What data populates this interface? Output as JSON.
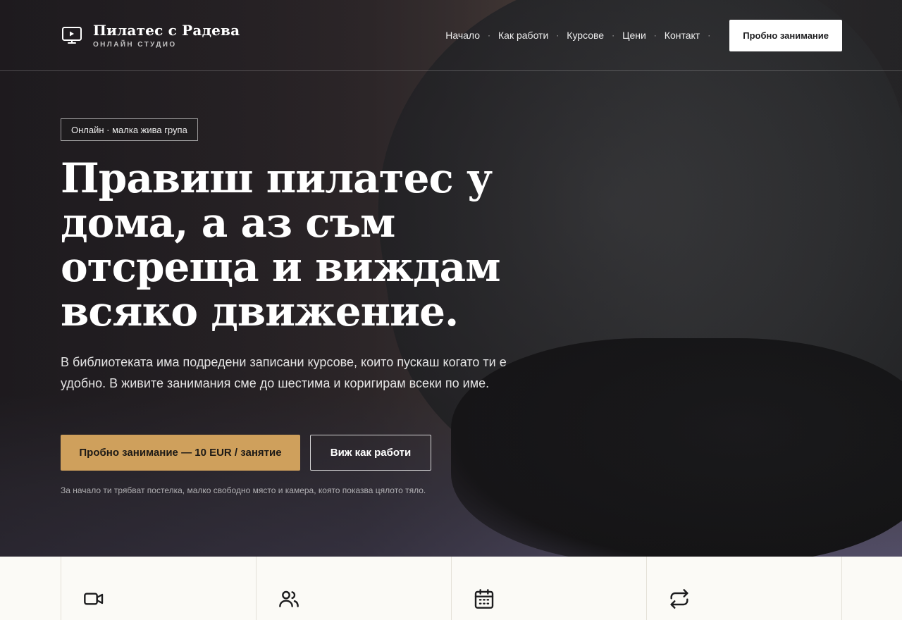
{
  "brand": {
    "title": "Пилатес с Радева",
    "subtitle": "ОНЛАЙН СТУДИО",
    "icon": "monitor-play-icon"
  },
  "nav": {
    "items": [
      {
        "label": "Начало"
      },
      {
        "label": "Как работи"
      },
      {
        "label": "Курсове"
      },
      {
        "label": "Цени"
      },
      {
        "label": "Контакт"
      }
    ],
    "separator": "·",
    "cta_label": "Пробно занимание"
  },
  "hero": {
    "badge": "Онлайн · малка жива група",
    "headline": "Правиш пилатес у дома, а аз съм отсреща и виждам всяко движение.",
    "lead": "В библиотеката има подредени записани курсове, които пускаш когато ти е удобно. В живите занимания сме до шестима и коригирам всеки по име.",
    "primary_cta": "Пробно занимание — 10 EUR / занятие",
    "secondary_cta": "Виж как работи",
    "note": "За начало ти трябват постелка, малко свободно място и камера, която показва цялото тяло."
  },
  "features": [
    {
      "icon": "video-camera-icon"
    },
    {
      "icon": "users-icon"
    },
    {
      "icon": "calendar-icon"
    },
    {
      "icon": "repeat-icon"
    }
  ],
  "colors": {
    "accent": "#cfa05c",
    "page_bg": "#fbfaf6"
  }
}
